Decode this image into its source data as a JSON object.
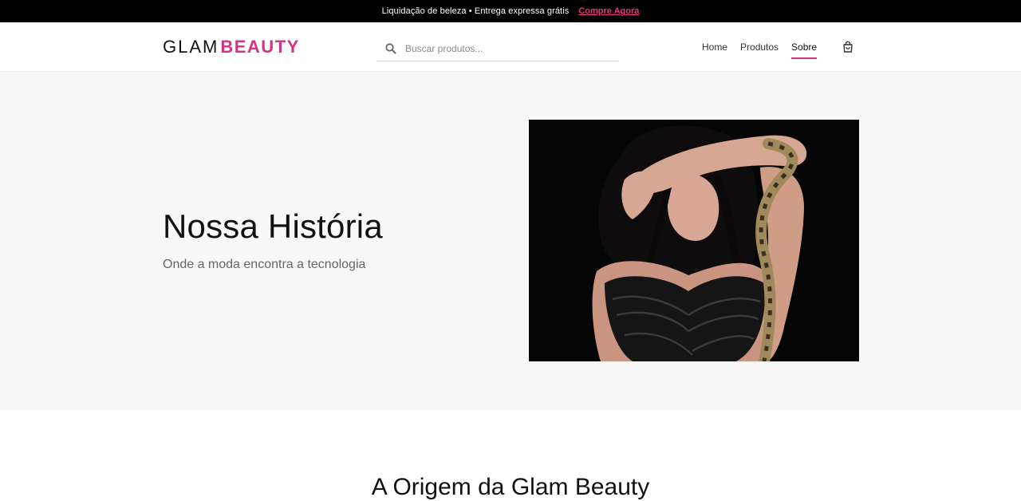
{
  "announcement": {
    "message": "Liquidação de beleza • Entrega expressa grátis",
    "cta": "Compre Agora"
  },
  "header": {
    "logo": {
      "part1": "GLAM",
      "part2": "BEAUTY"
    },
    "search": {
      "placeholder": "Buscar produtos...",
      "value": ""
    },
    "nav": [
      {
        "label": "Home"
      },
      {
        "label": "Produtos"
      },
      {
        "label": "Sobre"
      }
    ],
    "active_nav": "Sobre"
  },
  "hero": {
    "title": "Nossa História",
    "subtitle": "Onde a moda encontra a tecnologia"
  },
  "section": {
    "title": "A Origem da Glam Beauty"
  },
  "colors": {
    "accent": "#d63384",
    "topbar_bg": "#000000",
    "hero_bg": "#f8f8f8"
  },
  "icons": {
    "search": "search-icon",
    "cart": "shopping-bag-icon"
  }
}
